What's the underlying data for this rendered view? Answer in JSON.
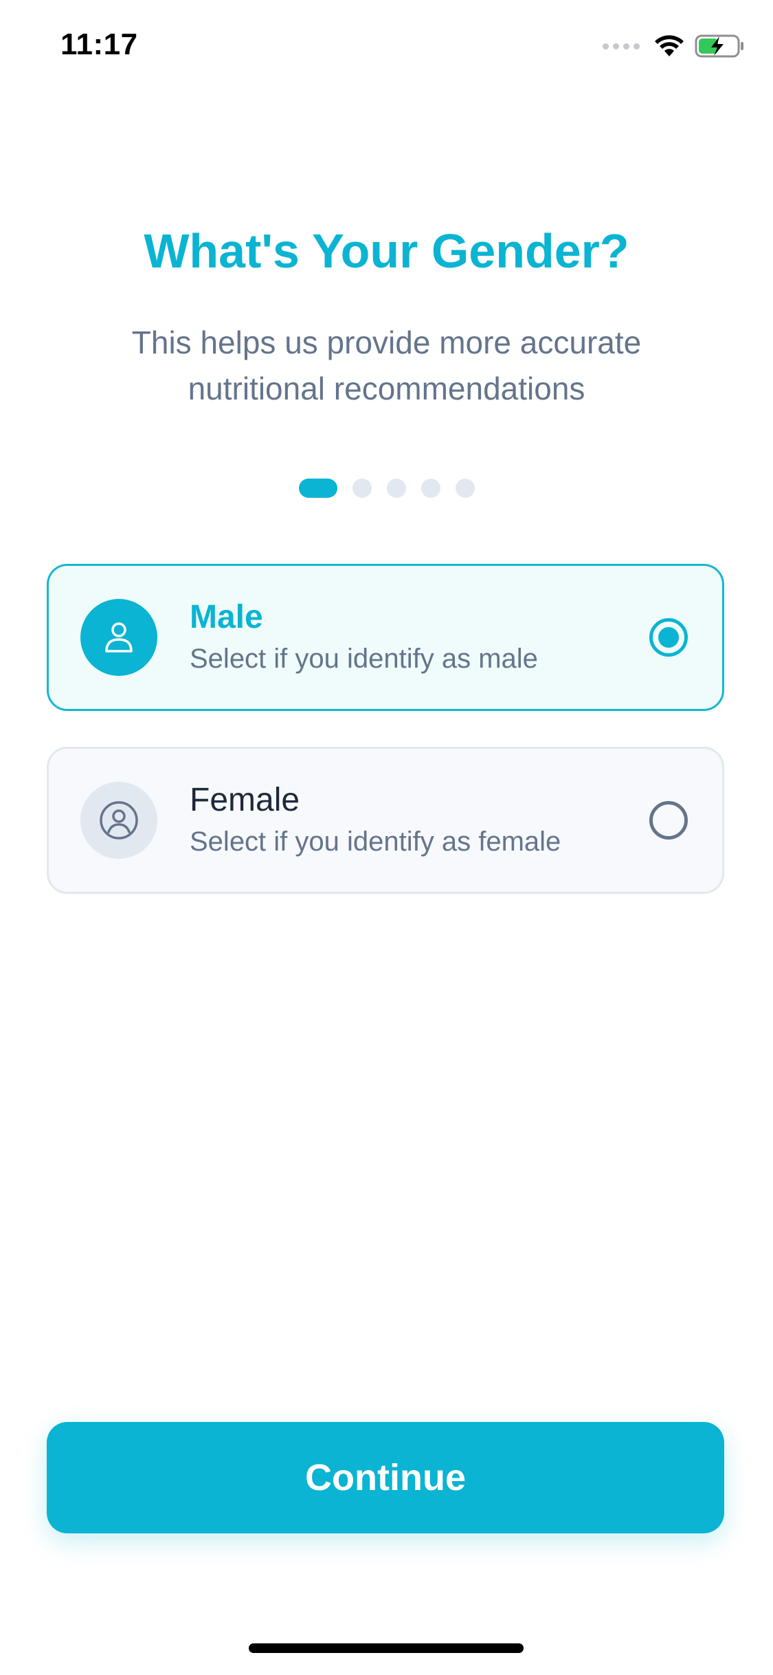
{
  "status_bar": {
    "time": "11:17",
    "icons": [
      "cellular-signal-icon",
      "wifi-icon",
      "battery-charging-icon"
    ]
  },
  "header": {
    "title": "What's Your Gender?",
    "subtitle": "This helps us provide more accurate nutritional recommendations"
  },
  "progress": {
    "total_steps": 5,
    "current_step": 1
  },
  "options": [
    {
      "label": "Male",
      "description": "Select if you identify as male",
      "icon": "user-icon",
      "selected": true
    },
    {
      "label": "Female",
      "description": "Select if you identify as female",
      "icon": "user-circle-icon",
      "selected": false
    }
  ],
  "colors": {
    "accent": "#0ab4d2",
    "selected_card_bg": "#effcfb",
    "card_bg": "#f7f9fc",
    "muted_text": "#64748b",
    "dark_text": "#1e293b"
  },
  "actions": {
    "continue_label": "Continue"
  }
}
